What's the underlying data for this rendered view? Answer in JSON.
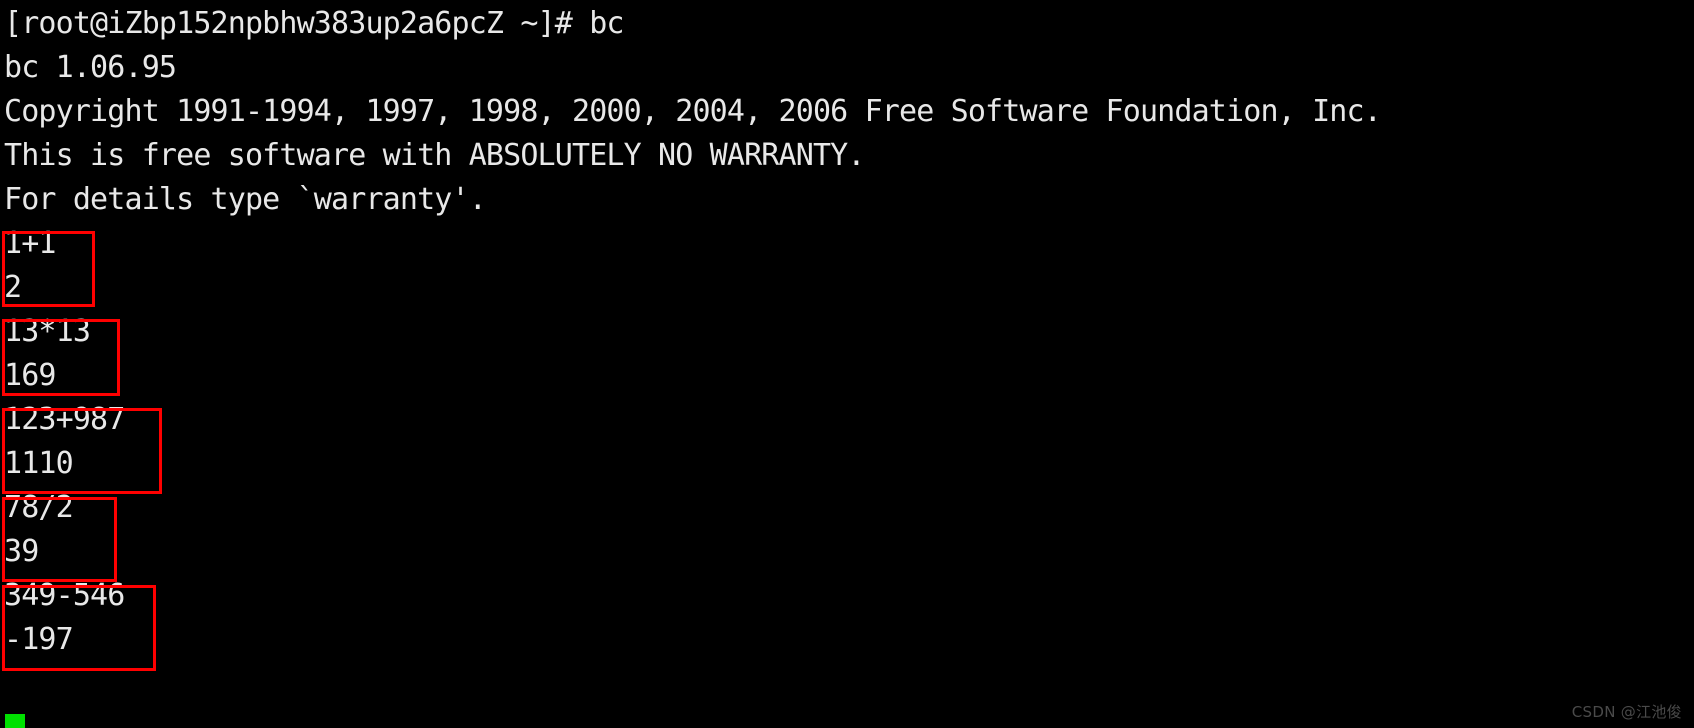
{
  "terminal": {
    "background_color": "#000000",
    "text_color": "#e8e8e8",
    "highlight_color": "#ff0000",
    "cursor_color": "#00e000",
    "lines": [
      "[root@iZbp152npbhw383up2a6pcZ ~]# bc",
      "bc 1.06.95",
      "Copyright 1991-1994, 1997, 1998, 2000, 2004, 2006 Free Software Foundation, Inc.",
      "This is free software with ABSOLUTELY NO WARRANTY.",
      "For details type `warranty'.",
      "1+1",
      "2",
      "13*13",
      "169",
      "123+987",
      "1110",
      "78/2",
      "39",
      "349-546",
      "-197"
    ],
    "prompt": "[root@iZbp152npbhw383up2a6pcZ ~]#",
    "command": "bc",
    "program_version": "bc 1.06.95",
    "calculations": [
      {
        "expression": "1+1",
        "result": "2"
      },
      {
        "expression": "13*13",
        "result": "169"
      },
      {
        "expression": "123+987",
        "result": "1110"
      },
      {
        "expression": "78/2",
        "result": "39"
      },
      {
        "expression": "349-546",
        "result": "-197"
      }
    ]
  },
  "watermark": {
    "text": "CSDN @江池俊"
  }
}
